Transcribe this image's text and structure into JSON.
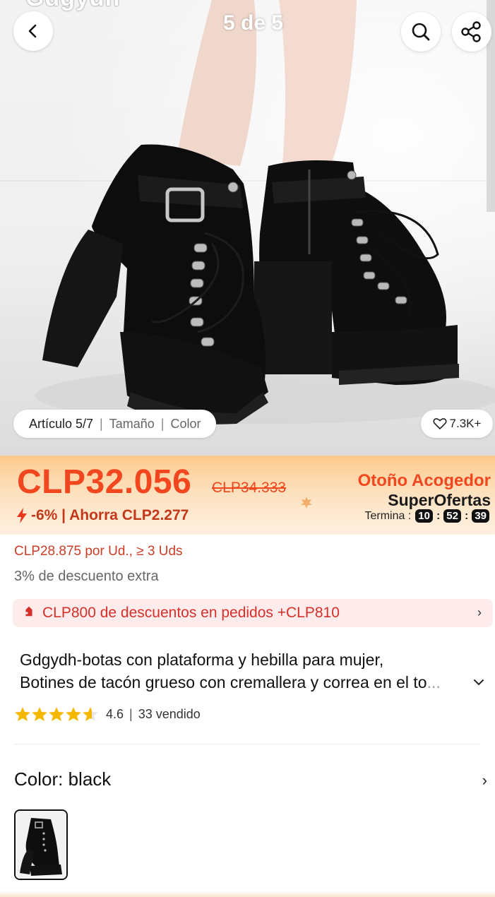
{
  "header": {
    "partial_title": "Gdgydh",
    "image_counter": "5 de 5"
  },
  "gallery": {
    "article_label": "Artículo 5/7",
    "option_size": "Tamaño",
    "option_color": "Color",
    "likes": "7.3K+"
  },
  "price": {
    "current": "CLP32.056",
    "original": "CLP34.333",
    "discount": "-6% | Ahorra CLP2.277",
    "campaign_title": "Otoño Acogedor",
    "campaign_subtitle": "SuperOfertas",
    "countdown_label": "Termina :",
    "countdown": [
      "10",
      "52",
      "39"
    ]
  },
  "offers": {
    "bulk_price": "CLP28.875 por Ud., ≥ 3 Uds",
    "extra_discount": "3% de descuento extra",
    "coupon": "CLP800 de descuentos en pedidos +CLP810",
    "coupon_chevron": "›"
  },
  "product": {
    "title_line1": "Gdgydh-botas con plataforma y hebilla para mujer,",
    "title_line2_main": "Botines de tacón grueso con cremallera y correa en el to",
    "title_line2_fade": "...",
    "rating": "4.6",
    "rating_sep": "|",
    "sold": "33 vendido",
    "stars_filled": 4.6
  },
  "variant": {
    "color_label": "Color: black",
    "chevron": "›"
  },
  "colors": {
    "accent": "#f2471e",
    "star": "#f5b800",
    "coupon_bg": "#fdeceb",
    "banner_top": "#fdc98c"
  },
  "icons": {
    "back": "chevron-left-icon",
    "search": "search-icon",
    "share": "share-icon",
    "heart": "heart-icon",
    "bolt": "lightning-icon",
    "tag": "tag-icon"
  }
}
